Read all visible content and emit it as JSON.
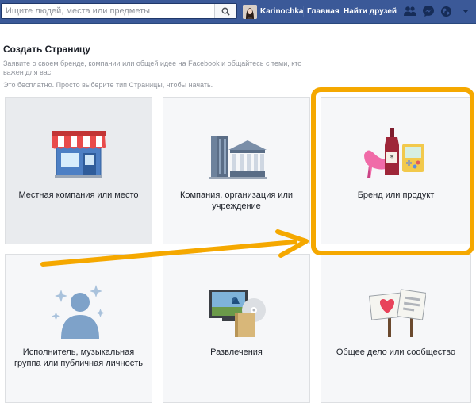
{
  "topbar": {
    "search_placeholder": "Ищите людей, места или предметы",
    "search_icon": "magnifier-icon",
    "username": "Karinochka",
    "nav_home": "Главная",
    "nav_find_friends": "Найти друзей",
    "icons": [
      "friend-requests-icon",
      "messages-icon",
      "notifications-globe-icon"
    ]
  },
  "page": {
    "title": "Создать Страницу",
    "description": "Заявите о своем бренде, компании или общей идее на Facebook и общайтесь с теми, кто важен для вас.",
    "instruction": "Это бесплатно. Просто выберите тип Страницы, чтобы начать."
  },
  "categories": [
    {
      "label": "Местная компания или место",
      "icon": "storefront-icon"
    },
    {
      "label": "Компания, организация или учреждение",
      "icon": "buildings-icon"
    },
    {
      "label": "Бренд или продукт",
      "icon": "products-icon"
    },
    {
      "label": "Исполнитель, музыкальная группа или публичная личность",
      "icon": "star-person-icon"
    },
    {
      "label": "Развлечения",
      "icon": "media-icon"
    },
    {
      "label": "Общее дело или сообщество",
      "icon": "signs-icon"
    }
  ],
  "colors": {
    "topbar": "#3b5998",
    "annotation": "#f5a800",
    "tile_bg": "#f6f7f9"
  }
}
